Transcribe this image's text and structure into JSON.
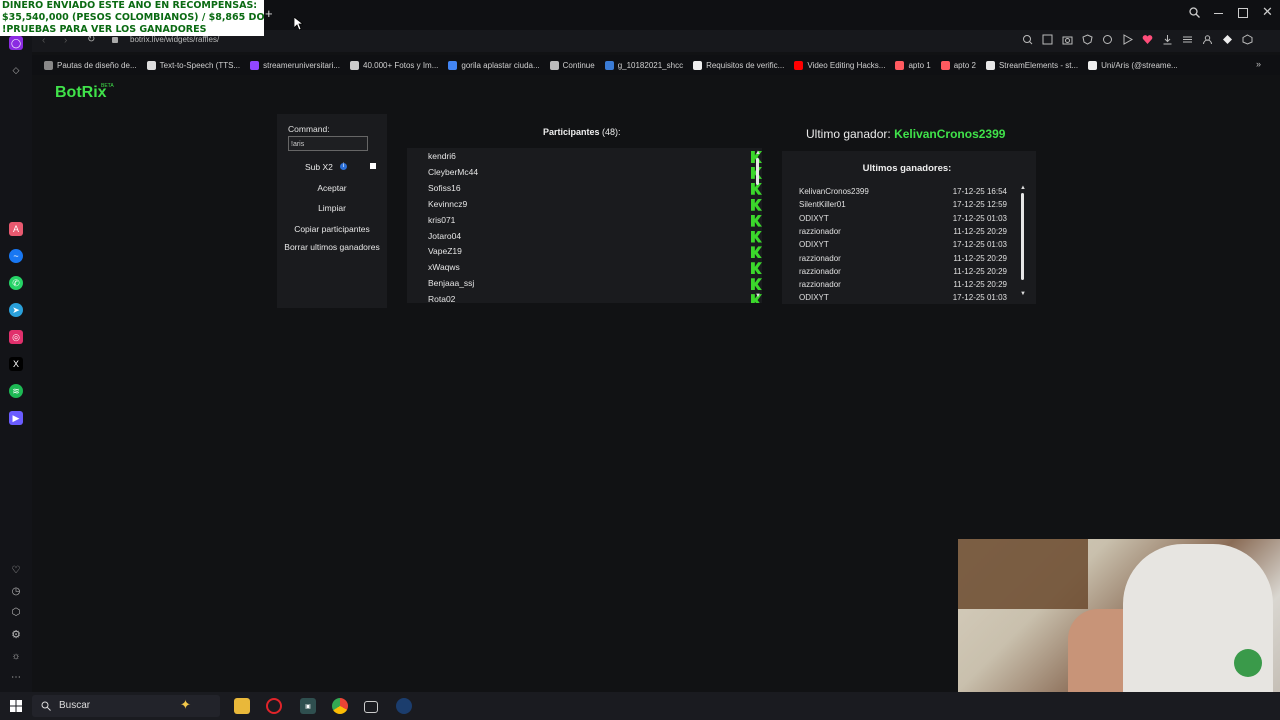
{
  "banner": {
    "line1": "DINERO ENVIADO ESTE AÑO EN RECOMPENSAS:",
    "line2": "$35,540,000 (PESOS COLOMBIANOS) / $8,865 DOLARES",
    "line3": "!PRUEBAS PARA VER LOS GANADORES"
  },
  "browser": {
    "url": "botrix.live/widgets/raffles/",
    "bookmarks": [
      {
        "label": "Pautas de diseño de...",
        "color": "#888888"
      },
      {
        "label": "Text-to-Speech (TTS...",
        "color": "#dddddd"
      },
      {
        "label": "streameruniversitari...",
        "color": "#9146ff"
      },
      {
        "label": "40.000+ Fotos y Im...",
        "color": "#cccccc"
      },
      {
        "label": "gorila aplastar ciuda...",
        "color": "#4285f4"
      },
      {
        "label": "Continue",
        "color": "#bbbbbb"
      },
      {
        "label": "g_10182021_shcc",
        "color": "#3a7bd5"
      },
      {
        "label": "Requisitos de verific...",
        "color": "#eeeeee"
      },
      {
        "label": "Video Editing Hacks...",
        "color": "#ff0000"
      },
      {
        "label": "apto 1",
        "color": "#ff5a5f"
      },
      {
        "label": "apto 2",
        "color": "#ff5a5f"
      },
      {
        "label": "StreamElements - st...",
        "color": "#e8e8e8"
      },
      {
        "label": "Uni/Aris (@streame...",
        "color": "#eeeeee"
      }
    ]
  },
  "app": {
    "logo": "BotRix",
    "logo_badge": "BETA"
  },
  "command": {
    "label": "Command:",
    "value": "!aris",
    "sub_label": "Sub X2",
    "buttons": [
      "Aceptar",
      "Limpiar",
      "Copiar participantes",
      "Borrar ultimos ganadores"
    ]
  },
  "participants": {
    "title": "Participantes",
    "count": "(48):",
    "names": [
      "kendri6",
      "CleyberMc44",
      "Sofiss16",
      "Kevinncz9",
      "kris071",
      "Jotaro04",
      "VapeZ19",
      "xWaqws",
      "Benjaaa_ssj",
      "Rota02"
    ]
  },
  "winners": {
    "last_label": "Ultimo ganador:",
    "last_name": "KelivanCronos2399",
    "list_title": "Ultimos ganadores:",
    "rows": [
      {
        "name": "KelivanCronos2399",
        "date": "17-12-25 16:54"
      },
      {
        "name": "SilentKiller01",
        "date": "17-12-25 12:59"
      },
      {
        "name": "ODIXYT",
        "date": "17-12-25 01:03"
      },
      {
        "name": "razzionador",
        "date": "11-12-25 20:29"
      },
      {
        "name": "ODIXYT",
        "date": "17-12-25 01:03"
      },
      {
        "name": "razzionador",
        "date": "11-12-25 20:29"
      },
      {
        "name": "razzionador",
        "date": "11-12-25 20:29"
      },
      {
        "name": "razzionador",
        "date": "11-12-25 20:29"
      },
      {
        "name": "ODIXYT",
        "date": "17-12-25 01:03"
      }
    ]
  },
  "taskbar": {
    "search_placeholder": "Buscar"
  },
  "colors": {
    "accent_green": "#40e24a",
    "kick_green": "#3bd82b",
    "panel_bg": "#1a1b1e"
  }
}
